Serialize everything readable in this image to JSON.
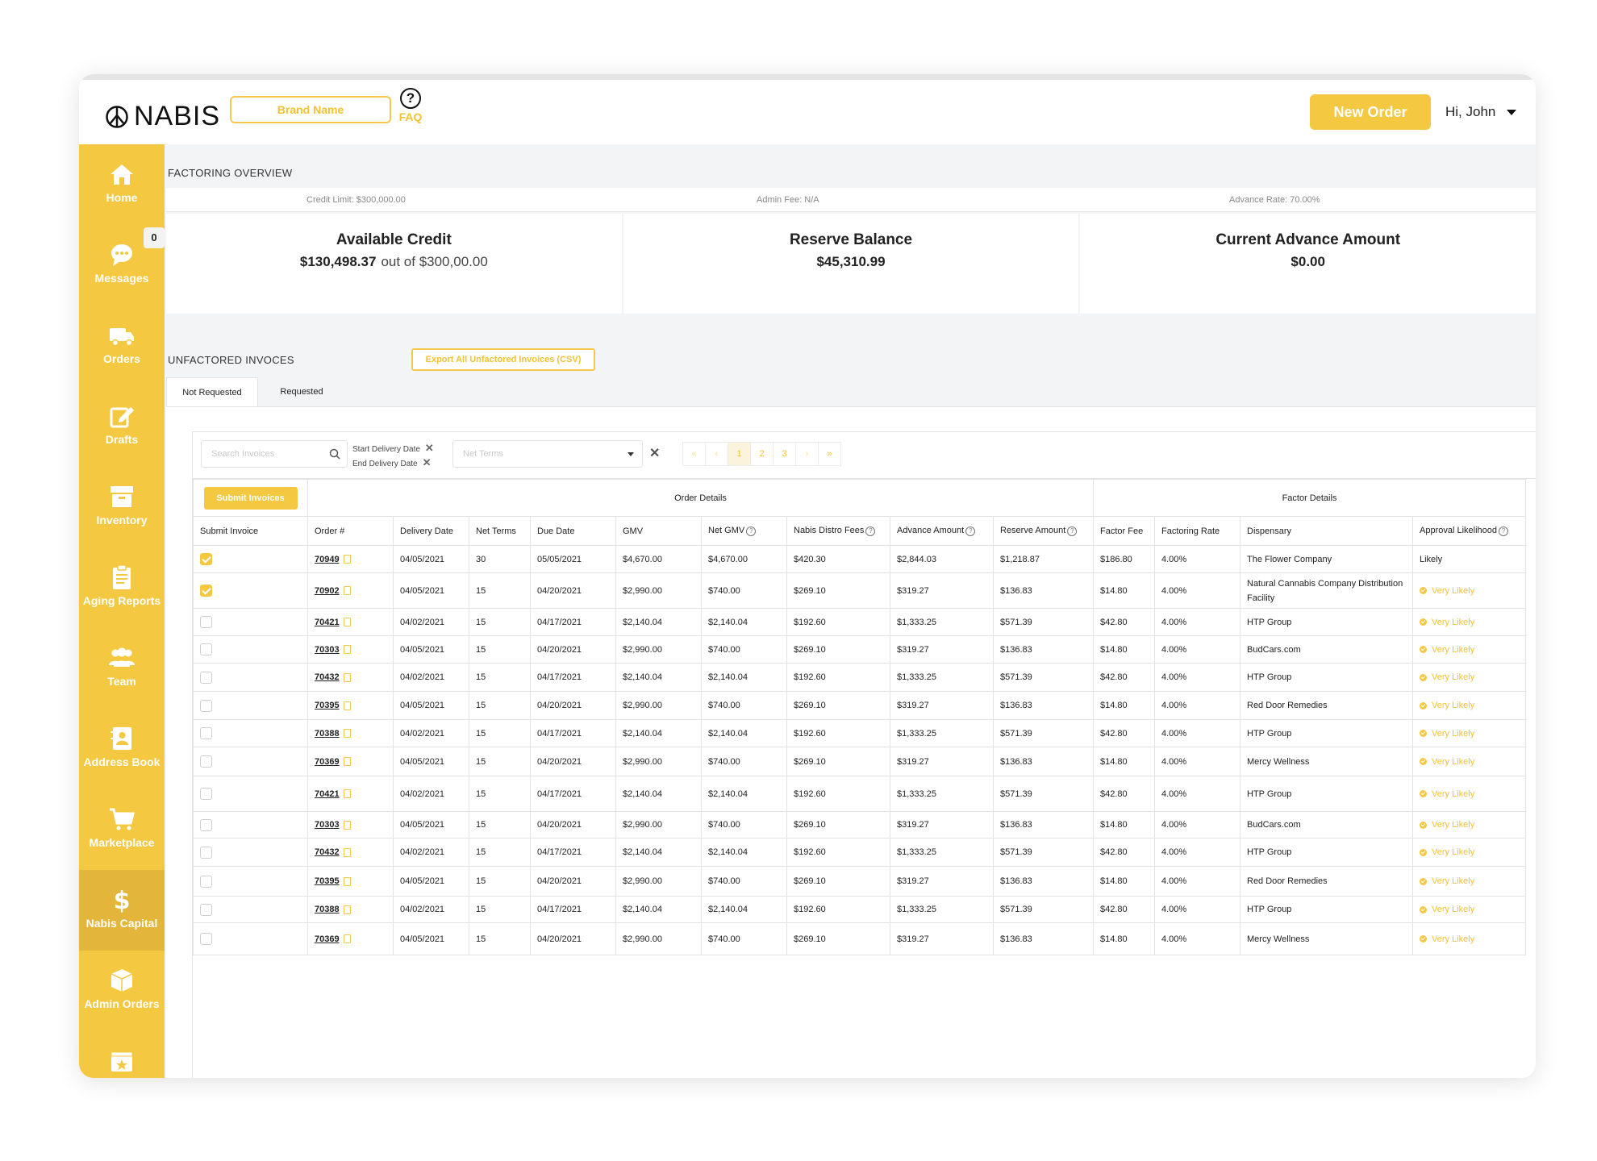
{
  "header": {
    "logo_text": "NABIS",
    "brand_name": "Brand Name",
    "faq_icon_glyph": "?",
    "faq_label": "FAQ",
    "new_order_label": "New Order",
    "user_greeting": "Hi, John"
  },
  "sidebar": {
    "messages_badge": "0",
    "items": [
      {
        "label": "Home",
        "icon": "home-icon"
      },
      {
        "label": "Messages",
        "icon": "chat-icon"
      },
      {
        "label": "Orders",
        "icon": "truck-icon"
      },
      {
        "label": "Drafts",
        "icon": "edit-icon"
      },
      {
        "label": "Inventory",
        "icon": "archive-icon"
      },
      {
        "label": "Aging Reports",
        "icon": "clipboard-icon"
      },
      {
        "label": "Team",
        "icon": "team-icon"
      },
      {
        "label": "Address Book",
        "icon": "address-book-icon"
      },
      {
        "label": "Marketplace",
        "icon": "cart-icon"
      },
      {
        "label": "Nabis Capital",
        "icon": "dollar-icon",
        "active": true
      },
      {
        "label": "Admin Orders",
        "icon": "box-icon"
      }
    ]
  },
  "overview": {
    "title": "FACTORING OVERVIEW",
    "credit_limit": "Credit Limit: $300,000.00",
    "admin_fee": "Admin Fee: N/A",
    "advance_rate": "Advance Rate: 70.00%",
    "cards": [
      {
        "title": "Available Credit",
        "value": "$130,498.37",
        "sub": "out of $300,00.00"
      },
      {
        "title": "Reserve Balance",
        "value": "$45,310.99",
        "sub": ""
      },
      {
        "title": "Current Advance Amount",
        "value": "$0.00",
        "sub": ""
      }
    ]
  },
  "invoices": {
    "title": "UNFACTORED INVOCES",
    "export_label": "Export All Unfactored Invoices (CSV)",
    "tabs": [
      "Not Requested",
      "Requested"
    ],
    "search_placeholder": "Search Invoices",
    "start_date_label": "Start Delivery Date",
    "end_date_label": "End Delivery Date",
    "net_terms_placeholder": "Net Terms",
    "pager": [
      "«",
      "‹",
      "1",
      "2",
      "3",
      "›",
      "»"
    ],
    "submit_label": "Submit Invoices",
    "group_order": "Order Details",
    "group_factor": "Factor Details",
    "columns": [
      "Submit Invoice",
      "Order #",
      "Delivery Date",
      "Net Terms",
      "Due Date",
      "GMV",
      "Net GMV",
      "Nabis Distro Fees",
      "Advance Amount",
      "Reserve Amount",
      "Factor Fee",
      "Factoring Rate",
      "Dispensary",
      "Approval Likelihood"
    ],
    "rows": [
      {
        "checked": true,
        "order": "70949",
        "delivery": "04/05/2021",
        "terms": "30",
        "due": "05/05/2021",
        "gmv": "$4,670.00",
        "net_gmv": "$4,670.00",
        "distro": "$420.30",
        "advance": "$2,844.03",
        "reserve": "$1,218.87",
        "fee": "$186.80",
        "rate": "4.00%",
        "dispensary": "The Flower Company",
        "likelihood": "Likely"
      },
      {
        "checked": true,
        "order": "70902",
        "delivery": "04/05/2021",
        "terms": "15",
        "due": "04/20/2021",
        "gmv": "$2,990.00",
        "net_gmv": "$740.00",
        "distro": "$269.10",
        "advance": "$319.27",
        "reserve": "$136.83",
        "fee": "$14.80",
        "rate": "4.00%",
        "dispensary": "Natural Cannabis Company Distribution Facility",
        "likelihood": "Very Likely"
      },
      {
        "checked": false,
        "order": "70421",
        "delivery": "04/02/2021",
        "terms": "15",
        "due": "04/17/2021",
        "gmv": "$2,140.04",
        "net_gmv": "$2,140.04",
        "distro": "$192.60",
        "advance": "$1,333.25",
        "reserve": "$571.39",
        "fee": "$42.80",
        "rate": "4.00%",
        "dispensary": "HTP Group",
        "likelihood": "Very Likely"
      },
      {
        "checked": false,
        "order": "70303",
        "delivery": "04/05/2021",
        "terms": "15",
        "due": "04/20/2021",
        "gmv": "$2,990.00",
        "net_gmv": "$740.00",
        "distro": "$269.10",
        "advance": "$319.27",
        "reserve": "$136.83",
        "fee": "$14.80",
        "rate": "4.00%",
        "dispensary": "BudCars.com",
        "likelihood": "Very Likely"
      },
      {
        "checked": false,
        "order": "70432",
        "delivery": "04/02/2021",
        "terms": "15",
        "due": "04/17/2021",
        "gmv": "$2,140.04",
        "net_gmv": "$2,140.04",
        "distro": "$192.60",
        "advance": "$1,333.25",
        "reserve": "$571.39",
        "fee": "$42.80",
        "rate": "4.00%",
        "dispensary": "HTP Group",
        "likelihood": "Very Likely"
      },
      {
        "checked": false,
        "order": "70395",
        "delivery": "04/05/2021",
        "terms": "15",
        "due": "04/20/2021",
        "gmv": "$2,990.00",
        "net_gmv": "$740.00",
        "distro": "$269.10",
        "advance": "$319.27",
        "reserve": "$136.83",
        "fee": "$14.80",
        "rate": "4.00%",
        "dispensary": "Red Door Remedies",
        "likelihood": "Very Likely"
      },
      {
        "checked": false,
        "order": "70388",
        "delivery": "04/02/2021",
        "terms": "15",
        "due": "04/17/2021",
        "gmv": "$2,140.04",
        "net_gmv": "$2,140.04",
        "distro": "$192.60",
        "advance": "$1,333.25",
        "reserve": "$571.39",
        "fee": "$42.80",
        "rate": "4.00%",
        "dispensary": "HTP Group",
        "likelihood": "Very Likely"
      },
      {
        "checked": false,
        "order": "70369",
        "delivery": "04/05/2021",
        "terms": "15",
        "due": "04/20/2021",
        "gmv": "$2,990.00",
        "net_gmv": "$740.00",
        "distro": "$269.10",
        "advance": "$319.27",
        "reserve": "$136.83",
        "fee": "$14.80",
        "rate": "4.00%",
        "dispensary": "Mercy Wellness",
        "likelihood": "Very Likely"
      },
      {
        "checked": false,
        "order": "70421",
        "delivery": "04/02/2021",
        "terms": "15",
        "due": "04/17/2021",
        "gmv": "$2,140.04",
        "net_gmv": "$2,140.04",
        "distro": "$192.60",
        "advance": "$1,333.25",
        "reserve": "$571.39",
        "fee": "$42.80",
        "rate": "4.00%",
        "dispensary": "HTP Group",
        "likelihood": "Very Likely"
      },
      {
        "checked": false,
        "order": "70303",
        "delivery": "04/05/2021",
        "terms": "15",
        "due": "04/20/2021",
        "gmv": "$2,990.00",
        "net_gmv": "$740.00",
        "distro": "$269.10",
        "advance": "$319.27",
        "reserve": "$136.83",
        "fee": "$14.80",
        "rate": "4.00%",
        "dispensary": "BudCars.com",
        "likelihood": "Very Likely"
      },
      {
        "checked": false,
        "order": "70432",
        "delivery": "04/02/2021",
        "terms": "15",
        "due": "04/17/2021",
        "gmv": "$2,140.04",
        "net_gmv": "$2,140.04",
        "distro": "$192.60",
        "advance": "$1,333.25",
        "reserve": "$571.39",
        "fee": "$42.80",
        "rate": "4.00%",
        "dispensary": "HTP Group",
        "likelihood": "Very Likely"
      },
      {
        "checked": false,
        "order": "70395",
        "delivery": "04/05/2021",
        "terms": "15",
        "due": "04/20/2021",
        "gmv": "$2,990.00",
        "net_gmv": "$740.00",
        "distro": "$269.10",
        "advance": "$319.27",
        "reserve": "$136.83",
        "fee": "$14.80",
        "rate": "4.00%",
        "dispensary": "Red Door Remedies",
        "likelihood": "Very Likely"
      },
      {
        "checked": false,
        "order": "70388",
        "delivery": "04/02/2021",
        "terms": "15",
        "due": "04/17/2021",
        "gmv": "$2,140.04",
        "net_gmv": "$2,140.04",
        "distro": "$192.60",
        "advance": "$1,333.25",
        "reserve": "$571.39",
        "fee": "$42.80",
        "rate": "4.00%",
        "dispensary": "HTP Group",
        "likelihood": "Very Likely"
      },
      {
        "checked": false,
        "order": "70369",
        "delivery": "04/05/2021",
        "terms": "15",
        "due": "04/20/2021",
        "gmv": "$2,990.00",
        "net_gmv": "$740.00",
        "distro": "$269.10",
        "advance": "$319.27",
        "reserve": "$136.83",
        "fee": "$14.80",
        "rate": "4.00%",
        "dispensary": "Mercy Wellness",
        "likelihood": "Very Likely"
      }
    ]
  },
  "colors": {
    "accent": "#f5c842",
    "accent_dark": "#e4b53b",
    "background": "#f3f4f6"
  }
}
